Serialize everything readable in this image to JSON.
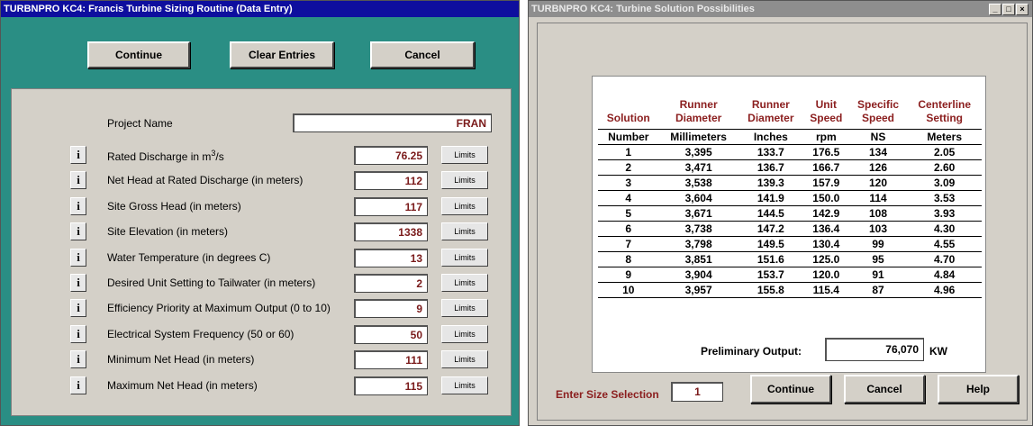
{
  "left": {
    "title": "TURBNPRO KC4: Francis Turbine Sizing Routine (Data Entry)",
    "buttons": {
      "continue": "Continue",
      "clear": "Clear Entries",
      "cancel": "Cancel"
    },
    "project_label": "Project Name",
    "project_value": "FRAN",
    "info_label": "i",
    "limits_label": "Limits",
    "fields": [
      {
        "label": "Rated Discharge in m",
        "sup": "3",
        "suffix": "/s",
        "value": "76.25"
      },
      {
        "label": "Net Head at Rated Discharge (in meters)",
        "sup": "",
        "suffix": "",
        "value": "112"
      },
      {
        "label": "Site Gross Head (in meters)",
        "sup": "",
        "suffix": "",
        "value": "117"
      },
      {
        "label": "Site Elevation (in meters)",
        "sup": "",
        "suffix": "",
        "value": "1338"
      },
      {
        "label": "Water Temperature (in degrees C)",
        "sup": "",
        "suffix": "",
        "value": "13"
      },
      {
        "label": "Desired Unit Setting to Tailwater (in meters)",
        "sup": "",
        "suffix": "",
        "value": "2"
      },
      {
        "label": "Efficiency Priority at Maximum Output (0 to 10)",
        "sup": "",
        "suffix": "",
        "value": "9"
      },
      {
        "label": "Electrical System Frequency (50 or 60)",
        "sup": "",
        "suffix": "",
        "value": "50"
      },
      {
        "label": "Minimum Net Head (in meters)",
        "sup": "",
        "suffix": "",
        "value": "111"
      },
      {
        "label": "Maximum Net Head (in meters)",
        "sup": "",
        "suffix": "",
        "value": "115"
      }
    ]
  },
  "right": {
    "title": "TURBNPRO KC4: Turbine Solution Possibilities",
    "window_controls": [
      "_",
      "□",
      "×"
    ],
    "headers": [
      [
        "Solution",
        ""
      ],
      [
        "Runner",
        "Diameter"
      ],
      [
        "Runner",
        "Diameter"
      ],
      [
        "Unit",
        "Speed"
      ],
      [
        "Specific",
        "Speed"
      ],
      [
        "Centerline",
        "Setting"
      ]
    ],
    "units": [
      "Number",
      "Millimeters",
      "Inches",
      "rpm",
      "NS",
      "Meters"
    ],
    "rows": [
      [
        "1",
        "3,395",
        "133.7",
        "176.5",
        "134",
        "2.05"
      ],
      [
        "2",
        "3,471",
        "136.7",
        "166.7",
        "126",
        "2.60"
      ],
      [
        "3",
        "3,538",
        "139.3",
        "157.9",
        "120",
        "3.09"
      ],
      [
        "4",
        "3,604",
        "141.9",
        "150.0",
        "114",
        "3.53"
      ],
      [
        "5",
        "3,671",
        "144.5",
        "142.9",
        "108",
        "3.93"
      ],
      [
        "6",
        "3,738",
        "147.2",
        "136.4",
        "103",
        "4.30"
      ],
      [
        "7",
        "3,798",
        "149.5",
        "130.4",
        "99",
        "4.55"
      ],
      [
        "8",
        "3,851",
        "151.6",
        "125.0",
        "95",
        "4.70"
      ],
      [
        "9",
        "3,904",
        "153.7",
        "120.0",
        "91",
        "4.84"
      ],
      [
        "10",
        "3,957",
        "155.8",
        "115.4",
        "87",
        "4.96"
      ]
    ],
    "output_label": "Preliminary Output:",
    "output_value": "76,070",
    "output_unit": "KW",
    "size_label": "Enter Size Selection",
    "size_value": "1",
    "buttons": {
      "continue": "Continue",
      "cancel": "Cancel",
      "help": "Help"
    }
  }
}
